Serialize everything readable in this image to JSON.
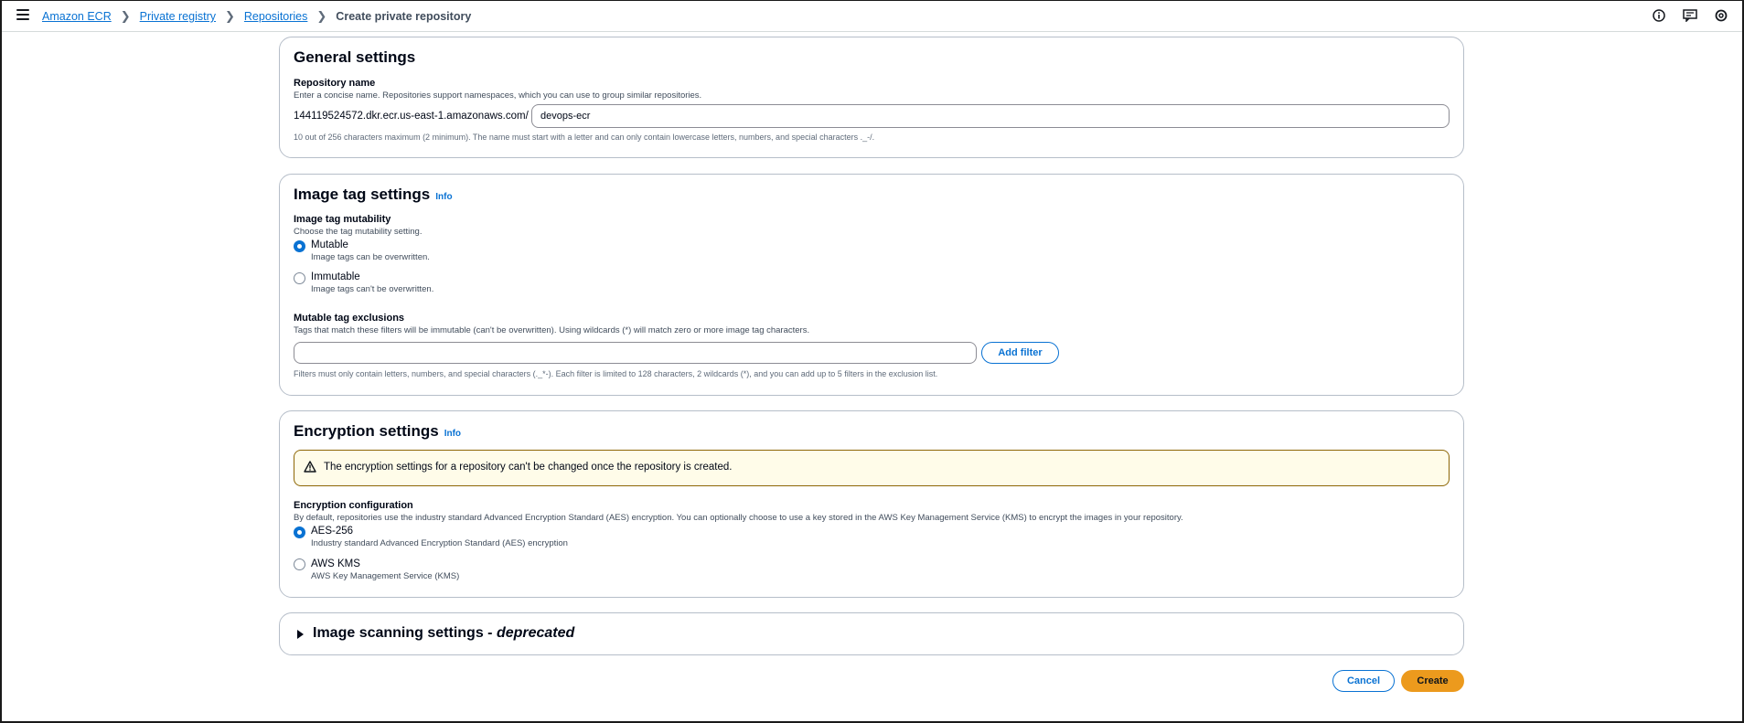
{
  "breadcrumb": {
    "items": [
      "Amazon ECR",
      "Private registry",
      "Repositories"
    ],
    "current": "Create private repository"
  },
  "icons": [
    "menu-icon",
    "info-icon",
    "feedback-icon",
    "settings-icon"
  ],
  "general": {
    "title": "General settings",
    "repo_label": "Repository name",
    "repo_desc": "Enter a concise name. Repositories support namespaces, which you can use to group similar repositories.",
    "prefix": "144119524572.dkr.ecr.us-east-1.amazonaws.com/",
    "repo_value": "devops-ecr",
    "repo_constraint": "10 out of 256 characters maximum (2 minimum). The name must start with a letter and can only contain lowercase letters, numbers, and special characters ._-/."
  },
  "image_tag": {
    "title": "Image tag settings",
    "info": "Info",
    "mutability_label": "Image tag mutability",
    "mutability_desc": "Choose the tag mutability setting.",
    "options": [
      {
        "label": "Mutable",
        "desc": "Image tags can be overwritten.",
        "checked": true
      },
      {
        "label": "Immutable",
        "desc": "Image tags can't be overwritten.",
        "checked": false
      }
    ],
    "exclusions_label": "Mutable tag exclusions",
    "exclusions_desc": "Tags that match these filters will be immutable (can't be overwritten). Using wildcards (*) will match zero or more image tag characters.",
    "filter_value": "",
    "add_filter": "Add filter",
    "filter_constraint": "Filters must only contain letters, numbers, and special characters (._*-). Each filter is limited to 128 characters, 2 wildcards (*), and you can add up to 5 filters in the exclusion list."
  },
  "encryption": {
    "title": "Encryption settings",
    "info": "Info",
    "alert": "The encryption settings for a repository can't be changed once the repository is created.",
    "config_label": "Encryption configuration",
    "config_desc": "By default, repositories use the industry standard Advanced Encryption Standard (AES) encryption. You can optionally choose to use a key stored in the AWS Key Management Service (KMS) to encrypt the images in your repository.",
    "options": [
      {
        "label": "AES-256",
        "desc": "Industry standard Advanced Encryption Standard (AES) encryption",
        "checked": true
      },
      {
        "label": "AWS KMS",
        "desc": "AWS Key Management Service (KMS)",
        "checked": false
      }
    ]
  },
  "scanning": {
    "title": "Image scanning settings - ",
    "title_em": "deprecated"
  },
  "actions": {
    "cancel": "Cancel",
    "create": "Create"
  },
  "colors": {
    "link": "#0972d3",
    "primary": "#ec9a1d",
    "warning_bg": "#fffce9",
    "warning_border": "#8d6605"
  }
}
